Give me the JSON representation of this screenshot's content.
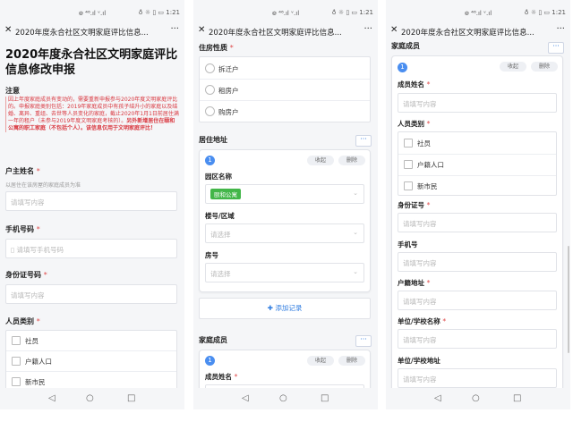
{
  "status": {
    "signal": "᪤ ⁴⁶.ıl ᵛ.ıl",
    "right": "♁ ☼ ▯ ▭ 1:21"
  },
  "app": {
    "title": "2020年度永合社区文明家庭评比信息...",
    "close": "✕",
    "more": "···"
  },
  "nav": {
    "back": "◁",
    "home": "○",
    "recent": "□"
  },
  "screen1": {
    "heading": "2020年度永合社区文明家庭评比信息修改申报",
    "note_title": "注意",
    "notice_text": "因上年度家庭成员有变动的，需要重新申报参与2020年度文明家庭评比的。申报家庭类别包括：2019年家庭成员中有孩子结升小的家庭以及结婚、离异、重组、去世等人员变化的家庭，截止2020年1月1日前居住满一年的租户（未参与2019年度文明家庭考核的）。",
    "notice_bold": "另外新增居住在颐和公寓的职工家庭（不包括个人）。该信息仅用于文明家庭评比！",
    "householder_label": "户主姓名",
    "required_mark": "*",
    "householder_hint": "以居住在该房屋的家庭成员为准",
    "placeholder": "请填写内容",
    "phone_label": "手机号码",
    "phone_placeholder": "请填写手机号码",
    "phone_icon": "▯",
    "id_label": "身份证号码",
    "category_label": "人员类别",
    "category_options": [
      "社员",
      "户籍人口",
      "新市民"
    ]
  },
  "screen2": {
    "housing_label": "住房性质",
    "housing_options": [
      "拆迁户",
      "租房户",
      "购房户"
    ],
    "address_title": "居住地址",
    "card_number": "1",
    "collapse": "收起",
    "delete": "删除",
    "park_label": "园区名称",
    "park_value": "颐和公寓",
    "building_label": "楼号/区域",
    "select_placeholder": "请选择",
    "room_label": "房号",
    "add_record": "✚ 添加记录",
    "family_title": "家庭成员",
    "member_name_label": "成员姓名",
    "chevron": "⌄"
  },
  "screen3": {
    "family_title": "家庭成员",
    "card_number": "1",
    "collapse": "收起",
    "delete": "删除",
    "member_name_label": "成员姓名",
    "placeholder": "请填写内容",
    "category_label": "人员类别",
    "category_options": [
      "社员",
      "户籍人口",
      "新市民"
    ],
    "id_label": "身份证号",
    "phone_label": "手机号",
    "household_address_label": "户籍地址",
    "workplace_label": "单位/学校名称",
    "workplace_address_label": "单位/学校地址",
    "more": "···"
  },
  "colors": {
    "accent": "#2f7ce0",
    "required": "#e04b4b",
    "notice": "#d9363e",
    "tag_green": "#43b649",
    "badge_blue": "#4a8ef0"
  }
}
